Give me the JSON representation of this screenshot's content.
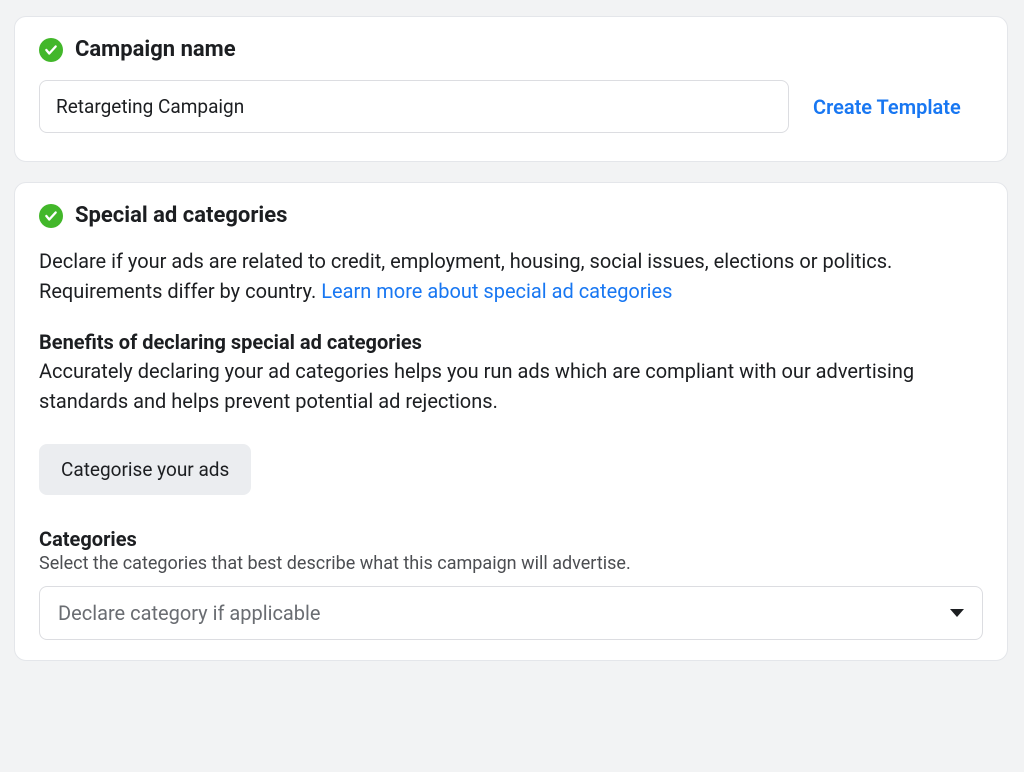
{
  "section1": {
    "title": "Campaign name",
    "input_value": "Retargeting Campaign",
    "create_template_label": "Create Template"
  },
  "section2": {
    "title": "Special ad categories",
    "description_start": "Declare if your ads are related to credit, employment, housing, social issues, elections or politics. Requirements differ by country. ",
    "description_link": "Learn more about special ad categories",
    "benefits_heading": "Benefits of declaring special ad categories",
    "benefits_text": "Accurately declaring your ad categories helps you run ads which are compliant with our advertising standards and helps prevent potential ad rejections.",
    "categorise_button": "Categorise your ads",
    "categories_label": "Categories",
    "categories_help": "Select the categories that best describe what this campaign will advertise.",
    "categories_placeholder": "Declare category if applicable"
  }
}
